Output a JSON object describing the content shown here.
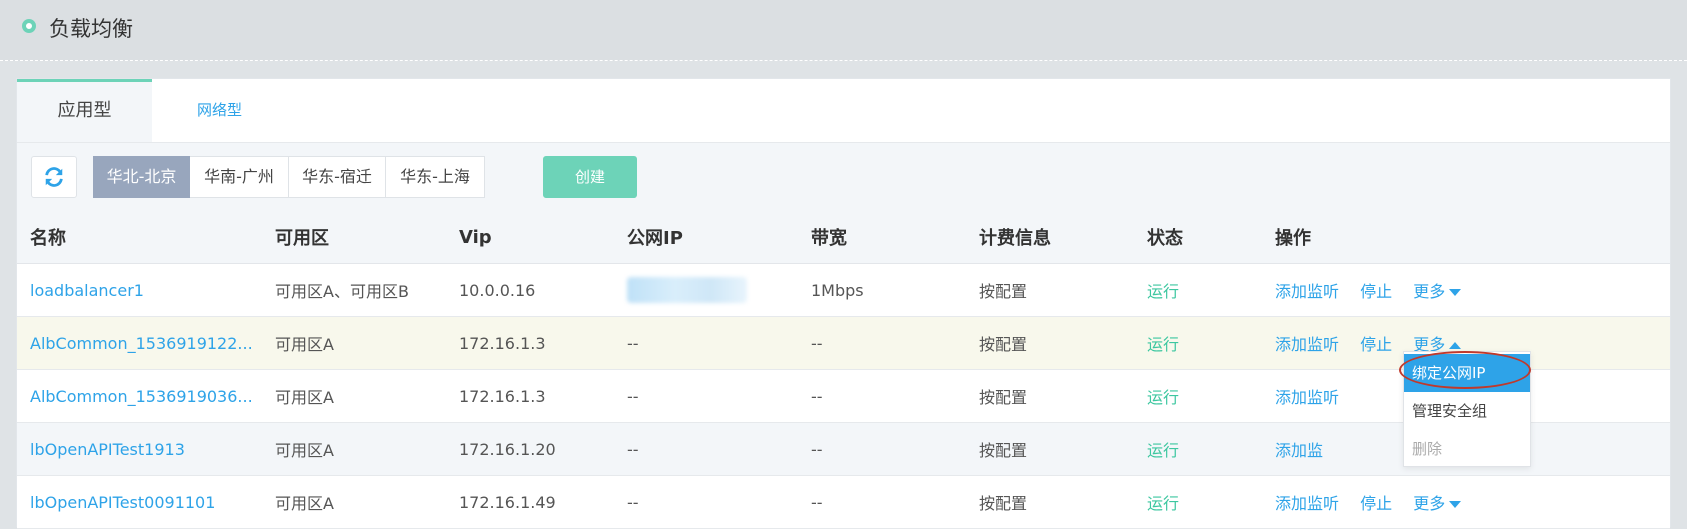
{
  "header": {
    "title": "负载均衡"
  },
  "tabs": [
    {
      "label": "应用型"
    },
    {
      "label": "网络型"
    }
  ],
  "toolbar": {
    "regions": [
      "华北-北京",
      "华南-广州",
      "华东-宿迁",
      "华东-上海"
    ],
    "create_label": "创建"
  },
  "table": {
    "headers": [
      "名称",
      "可用区",
      "Vip",
      "公网IP",
      "带宽",
      "计费信息",
      "状态",
      "操作"
    ],
    "rows": [
      {
        "name": "loadbalancer1",
        "zone": "可用区A、可用区B",
        "vip": "10.0.0.16",
        "public_ip": "",
        "bandwidth": "1Mbps",
        "billing": "按配置",
        "status": "运行",
        "op_listen": "添加监听",
        "op_stop": "停止",
        "op_more": "更多"
      },
      {
        "name": "AlbCommon_1536919122...",
        "zone": "可用区A",
        "vip": "172.16.1.3",
        "public_ip": "--",
        "bandwidth": "--",
        "billing": "按配置",
        "status": "运行",
        "op_listen": "添加监听",
        "op_stop": "停止",
        "op_more": "更多"
      },
      {
        "name": "AlbCommon_1536919036...",
        "zone": "可用区A",
        "vip": "172.16.1.3",
        "public_ip": "--",
        "bandwidth": "--",
        "billing": "按配置",
        "status": "运行",
        "op_listen": "添加监听",
        "op_stop": "",
        "op_more": ""
      },
      {
        "name": "lbOpenAPITest1913",
        "zone": "可用区A",
        "vip": "172.16.1.20",
        "public_ip": "--",
        "bandwidth": "--",
        "billing": "按配置",
        "status": "运行",
        "op_listen": "添加监",
        "op_stop": "",
        "op_more": ""
      },
      {
        "name": "lbOpenAPITest0091101",
        "zone": "可用区A",
        "vip": "172.16.1.49",
        "public_ip": "--",
        "bandwidth": "--",
        "billing": "按配置",
        "status": "运行",
        "op_listen": "添加监听",
        "op_stop": "停止",
        "op_more": "更多"
      }
    ]
  },
  "dropdown": {
    "items": [
      "绑定公网IP",
      "管理安全组",
      "删除"
    ]
  },
  "colors": {
    "accent": "#2ea3e8",
    "brand": "#6dd3b8",
    "status_running": "#3dc7a0",
    "active_region": "#98a6bd",
    "highlight_ring": "#c0392b"
  }
}
